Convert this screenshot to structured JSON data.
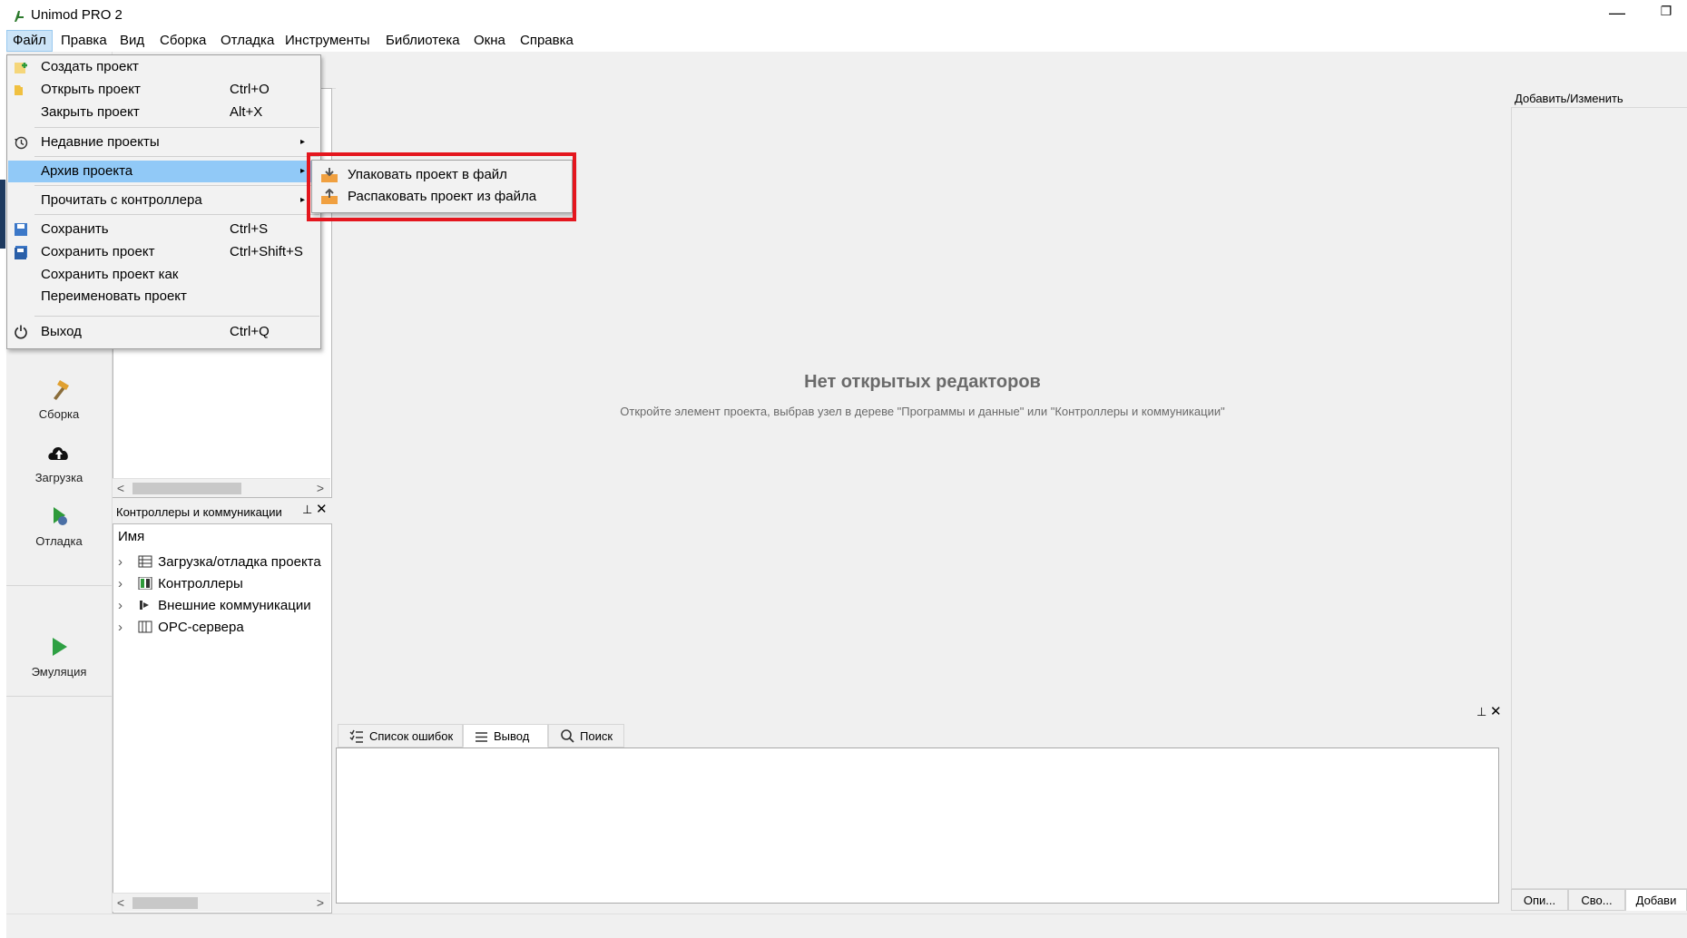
{
  "app": {
    "title": "Unimod PRO 2",
    "minimize": "—",
    "maximize": "❐"
  },
  "menubar": {
    "items": [
      "Файл",
      "Правка",
      "Вид",
      "Сборка",
      "Отладка",
      "Инструменты",
      "Библиотека",
      "Окна",
      "Справка"
    ]
  },
  "file_menu": {
    "items": [
      {
        "label": "Создать проект",
        "shortcut": ""
      },
      {
        "label": "Открыть проект",
        "shortcut": "Ctrl+O"
      },
      {
        "label": "Закрыть проект",
        "shortcut": "Alt+X"
      },
      {
        "label": "Недавние проекты",
        "shortcut": ""
      },
      {
        "label": "Архив проекта",
        "shortcut": ""
      },
      {
        "label": "Прочитать с контроллера",
        "shortcut": ""
      },
      {
        "label": "Сохранить",
        "shortcut": "Ctrl+S"
      },
      {
        "label": "Сохранить проект",
        "shortcut": "Ctrl+Shift+S"
      },
      {
        "label": "Сохранить проект как",
        "shortcut": ""
      },
      {
        "label": "Переименовать проект",
        "shortcut": ""
      },
      {
        "label": "Выход",
        "shortcut": "Ctrl+Q"
      }
    ],
    "submenu_arrow": "▸"
  },
  "archive_submenu": {
    "items": [
      {
        "label": "Упаковать проект в файл"
      },
      {
        "label": "Распаковать проект из файла"
      }
    ]
  },
  "sidebar": {
    "buttons": [
      {
        "label": "Сборка",
        "icon": "hammer-icon"
      },
      {
        "label": "Загрузка",
        "icon": "cloud-upload-icon"
      },
      {
        "label": "Отладка",
        "icon": "debug-icon"
      },
      {
        "label": "Эмуляция",
        "icon": "play-icon"
      }
    ]
  },
  "controllers_panel": {
    "title": "Контроллеры и коммуникации",
    "pin": "⊥",
    "close": "✕",
    "column_header": "Имя",
    "tree": [
      {
        "label": "Загрузка/отладка проекта",
        "icon": "table-icon"
      },
      {
        "label": "Контроллеры",
        "icon": "controller-icon"
      },
      {
        "label": "Внешние коммуникации",
        "icon": "comm-icon"
      },
      {
        "label": "OPC-сервера",
        "icon": "server-icon"
      }
    ],
    "expand_glyph": "›"
  },
  "editor": {
    "empty_title": "Нет открытых редакторов",
    "empty_hint": "Откройте элемент проекта, выбрав узел в дереве \"Программы и данные\" или \"Контроллеры и коммуникации\""
  },
  "right_panel": {
    "title": "Добавить/Изменить",
    "tabs": [
      "Опи...",
      "Сво...",
      "Добави"
    ]
  },
  "output_panel": {
    "pin": "⊥",
    "close": "✕",
    "tabs": [
      {
        "label": "Список ошибок",
        "icon": "list-check-icon"
      },
      {
        "label": "Вывод",
        "icon": "lines-icon"
      },
      {
        "label": "Поиск",
        "icon": "search-icon"
      }
    ],
    "active_tab": "Вывод"
  },
  "scroll": {
    "left": "<",
    "right": ">"
  },
  "colors": {
    "menu_highlight": "#91c9f7",
    "annotation_red": "#e4161e",
    "accent_green": "#2e9a3a"
  }
}
